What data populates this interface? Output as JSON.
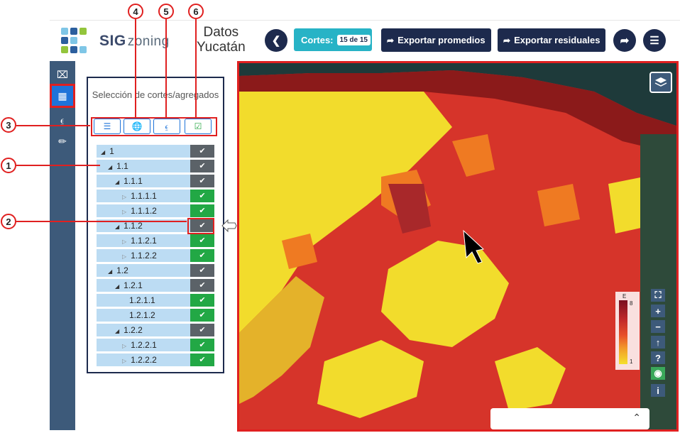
{
  "header": {
    "brand_bold": "SIG",
    "brand_rest": "zoning",
    "dataset_line1": "Datos",
    "dataset_line2": "Yucatán",
    "back_icon": "chevron-left-icon",
    "cortes_label": "Cortes:",
    "cortes_count": "15 de 15",
    "export_avg_label": "Exportar promedios",
    "export_res_label": "Exportar residuales",
    "share_icon": "share-icon",
    "menu_icon": "menu-icon"
  },
  "sidebar": {
    "items": [
      {
        "icon": "map-icon"
      },
      {
        "icon": "layers-icon"
      },
      {
        "icon": "hierarchy-icon"
      },
      {
        "icon": "brush-icon"
      }
    ]
  },
  "panel": {
    "title": "Selección de cortes/agregados",
    "tools": [
      {
        "icon": "list-check-icon"
      },
      {
        "icon": "globe-icon"
      },
      {
        "icon": "hierarchy-icon"
      },
      {
        "icon": "check-square-icon"
      }
    ],
    "tree": [
      {
        "label": "1",
        "level": 0,
        "leaf": false,
        "state": "grey"
      },
      {
        "label": "1.1",
        "level": 1,
        "leaf": false,
        "state": "grey"
      },
      {
        "label": "1.1.1",
        "level": 2,
        "leaf": false,
        "state": "grey"
      },
      {
        "label": "1.1.1.1",
        "level": 3,
        "leaf": true,
        "state": "green"
      },
      {
        "label": "1.1.1.2",
        "level": 3,
        "leaf": true,
        "state": "green"
      },
      {
        "label": "1.1.2",
        "level": 2,
        "leaf": false,
        "state": "grey"
      },
      {
        "label": "1.1.2.1",
        "level": 3,
        "leaf": true,
        "state": "green"
      },
      {
        "label": "1.1.2.2",
        "level": 3,
        "leaf": true,
        "state": "green"
      },
      {
        "label": "1.2",
        "level": 1,
        "leaf": false,
        "state": "grey"
      },
      {
        "label": "1.2.1",
        "level": 2,
        "leaf": false,
        "state": "grey"
      },
      {
        "label": "1.2.1.1",
        "level": 3,
        "leaf": null,
        "state": "green"
      },
      {
        "label": "1.2.1.2",
        "level": 3,
        "leaf": null,
        "state": "green"
      },
      {
        "label": "1.2.2",
        "level": 2,
        "leaf": false,
        "state": "grey"
      },
      {
        "label": "1.2.2.1",
        "level": 3,
        "leaf": true,
        "state": "green"
      },
      {
        "label": "1.2.2.2",
        "level": 3,
        "leaf": true,
        "state": "green"
      }
    ]
  },
  "map": {
    "legend_title": "E",
    "legend_max": "8",
    "legend_min": "1",
    "controls": [
      "fullscreen-icon",
      "zoom-in-icon",
      "zoom-out-icon",
      "north-arrow-icon",
      "help-icon",
      "visibility-off-icon",
      "info-icon"
    ],
    "colors": {
      "dark": "#8b1a1a",
      "red": "#d6342a",
      "orange": "#ef7a22",
      "yellow": "#f2dc2c"
    }
  },
  "annotations": [
    "1",
    "2",
    "3",
    "4",
    "5",
    "6"
  ]
}
